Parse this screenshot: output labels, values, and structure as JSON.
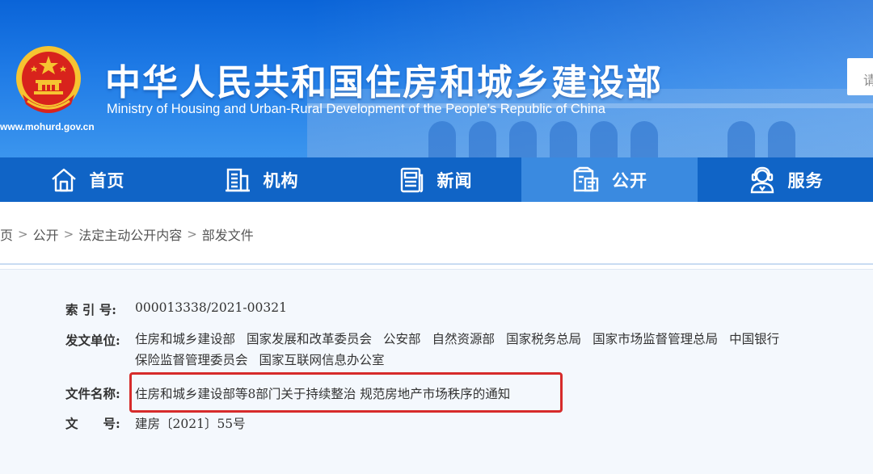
{
  "header": {
    "title": "中华人民共和国住房和城乡建设部",
    "subtitle": "Ministry of Housing and Urban-Rural Development of the People’s Republic of China",
    "url": "www.mohurd.gov.cn",
    "search_placeholder": "请",
    "colors": {
      "banner_top": "#0a64d8",
      "banner_bottom": "#3b95ee",
      "emblem_red": "#d8231c",
      "emblem_gold": "#f6c431"
    }
  },
  "nav": {
    "items": [
      {
        "label": "首页",
        "icon": "home-icon"
      },
      {
        "label": "机构",
        "icon": "building-icon"
      },
      {
        "label": "新闻",
        "icon": "newspaper-icon"
      },
      {
        "label": "公开",
        "icon": "document-folder-icon",
        "active": true
      },
      {
        "label": "服务",
        "icon": "service-person-icon"
      }
    ],
    "colors": {
      "bar": "#1064c6",
      "active": "#3a8ae0"
    }
  },
  "breadcrumb": {
    "items": [
      "页",
      "公开",
      "法定主动公开内容",
      "部发文件"
    ],
    "separator": ">"
  },
  "document": {
    "index_label": "索 引 号:",
    "index_value": "000013338/2021-00321",
    "issuer_label": "发文单位:",
    "issuers_line1": [
      "住房和城乡建设部",
      "国家发展和改革委员会",
      "公安部",
      "自然资源部",
      "国家税务总局",
      "国家市场监督管理总局",
      "中国银行"
    ],
    "issuers_line2": [
      "保险监督管理委员会",
      "国家互联网信息办公室"
    ],
    "name_label": "文件名称:",
    "name_value": "住房和城乡建设部等8部门关于持续整治 规范房地产市场秩序的通知",
    "number_label": "文　　号:",
    "number_value": "建房〔2021〕55号",
    "highlight_color": "#d62b2b"
  }
}
